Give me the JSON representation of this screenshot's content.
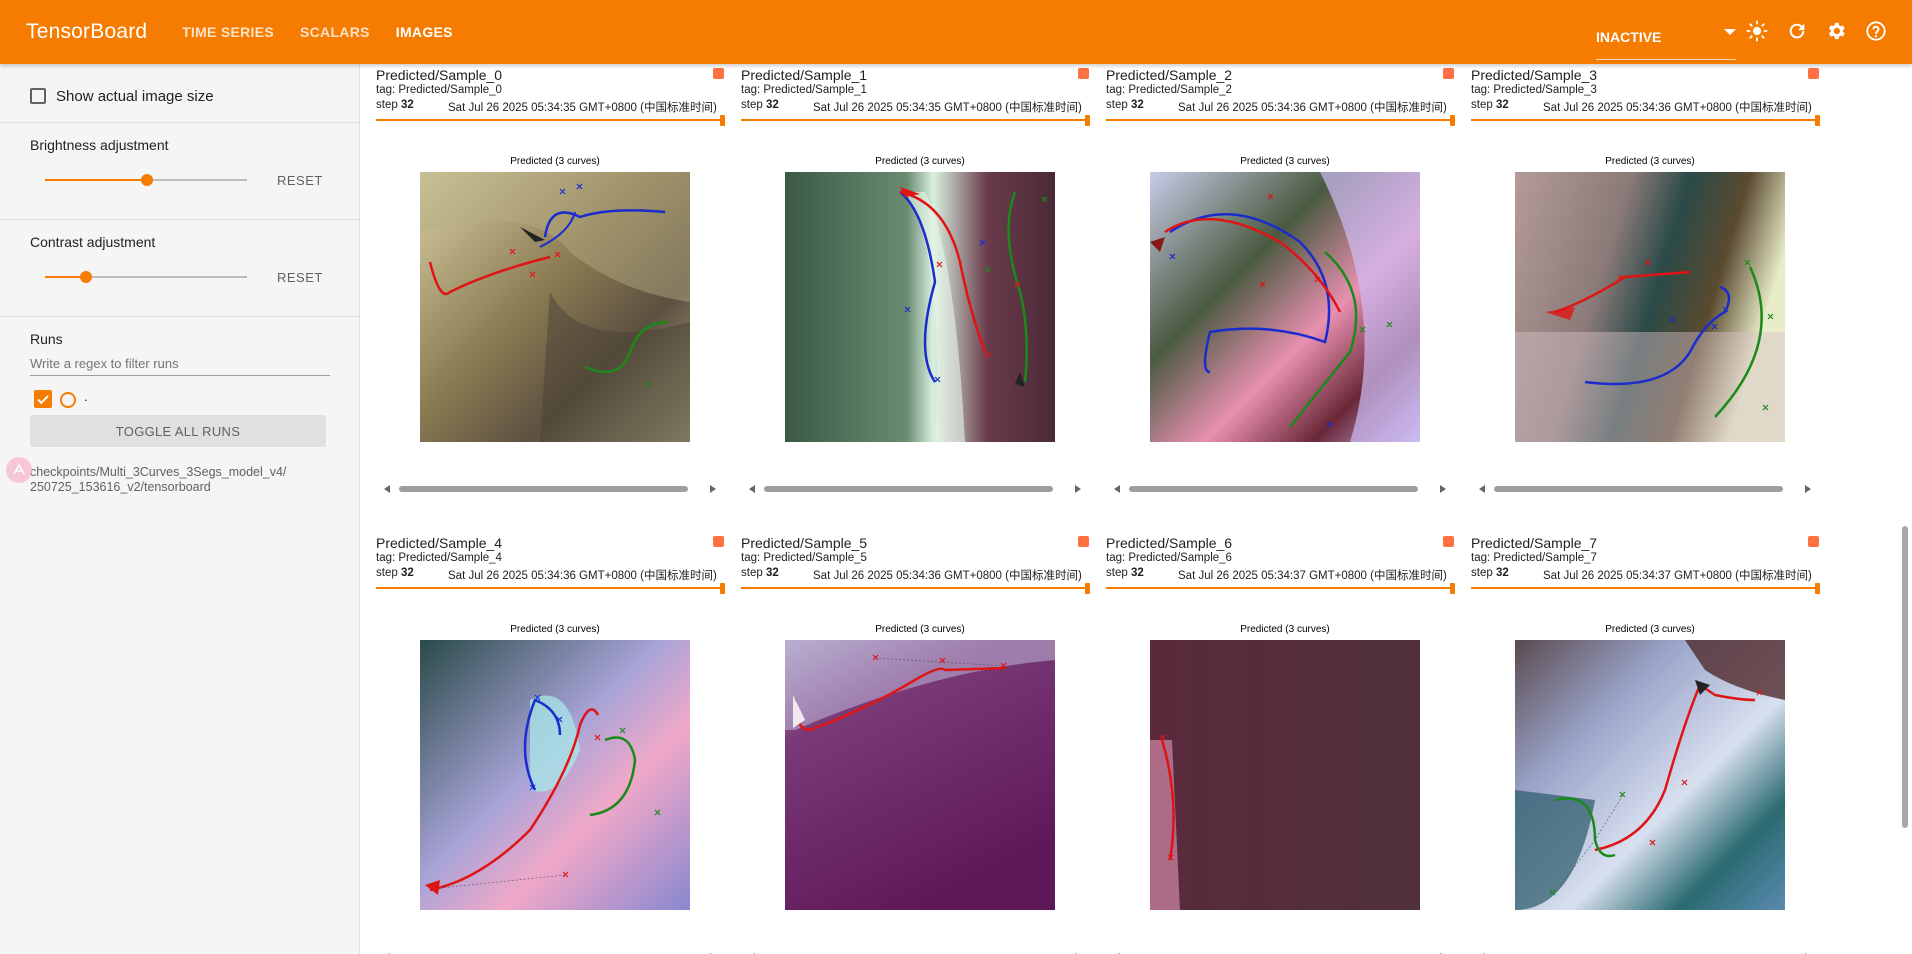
{
  "topbar": {
    "brand": "TensorBoard",
    "tabs": [
      {
        "label": "TIME SERIES",
        "active": false
      },
      {
        "label": "SCALARS",
        "active": false
      },
      {
        "label": "IMAGES",
        "active": true
      }
    ],
    "status": "INACTIVE",
    "icons": [
      "theme-sun-icon",
      "refresh-icon",
      "settings-gear-icon",
      "help-icon"
    ],
    "accent_color": "#f57c00"
  },
  "sidebar": {
    "show_actual_size": "Show actual image size",
    "brightness": {
      "label": "Brightness adjustment",
      "reset": "RESET",
      "value": 0.5
    },
    "contrast": {
      "label": "Contrast adjustment",
      "reset": "RESET",
      "value": 0.2
    },
    "runs": {
      "label": "Runs",
      "filter_placeholder": "Write a regex to filter runs",
      "run_name": ".",
      "run_color": "#f57c00",
      "toggle_all": "TOGGLE ALL RUNS",
      "path_line1": "checkpoints/Multi_3Curves_3Segs_model_v4/",
      "path_line2": "250725_153616_v2/tensorboard"
    }
  },
  "cards": [
    {
      "title": "Predicted/Sample_0",
      "tag": "tag: Predicted/Sample_0",
      "step_label": "step",
      "step": "32",
      "time": "Sat Jul 26 2025 05:34:35 GMT+0800 (中国标准时间)",
      "plot_title": "Predicted (3 curves)"
    },
    {
      "title": "Predicted/Sample_1",
      "tag": "tag: Predicted/Sample_1",
      "step_label": "step",
      "step": "32",
      "time": "Sat Jul 26 2025 05:34:35 GMT+0800 (中国标准时间)",
      "plot_title": "Predicted (3 curves)"
    },
    {
      "title": "Predicted/Sample_2",
      "tag": "tag: Predicted/Sample_2",
      "step_label": "step",
      "step": "32",
      "time": "Sat Jul 26 2025 05:34:36 GMT+0800 (中国标准时间)",
      "plot_title": "Predicted (3 curves)"
    },
    {
      "title": "Predicted/Sample_3",
      "tag": "tag: Predicted/Sample_3",
      "step_label": "step",
      "step": "32",
      "time": "Sat Jul 26 2025 05:34:36 GMT+0800 (中国标准时间)",
      "plot_title": "Predicted (3 curves)"
    },
    {
      "title": "Predicted/Sample_4",
      "tag": "tag: Predicted/Sample_4",
      "step_label": "step",
      "step": "32",
      "time": "Sat Jul 26 2025 05:34:36 GMT+0800 (中国标准时间)",
      "plot_title": "Predicted (3 curves)"
    },
    {
      "title": "Predicted/Sample_5",
      "tag": "tag: Predicted/Sample_5",
      "step_label": "step",
      "step": "32",
      "time": "Sat Jul 26 2025 05:34:36 GMT+0800 (中国标准时间)",
      "plot_title": "Predicted (3 curves)"
    },
    {
      "title": "Predicted/Sample_6",
      "tag": "tag: Predicted/Sample_6",
      "step_label": "step",
      "step": "32",
      "time": "Sat Jul 26 2025 05:34:37 GMT+0800 (中国标准时间)",
      "plot_title": "Predicted (3 curves)"
    },
    {
      "title": "Predicted/Sample_7",
      "tag": "tag: Predicted/Sample_7",
      "step_label": "step",
      "step": "32",
      "time": "Sat Jul 26 2025 05:34:37 GMT+0800 (中国标准时间)",
      "plot_title": "Predicted (3 curves)"
    }
  ]
}
